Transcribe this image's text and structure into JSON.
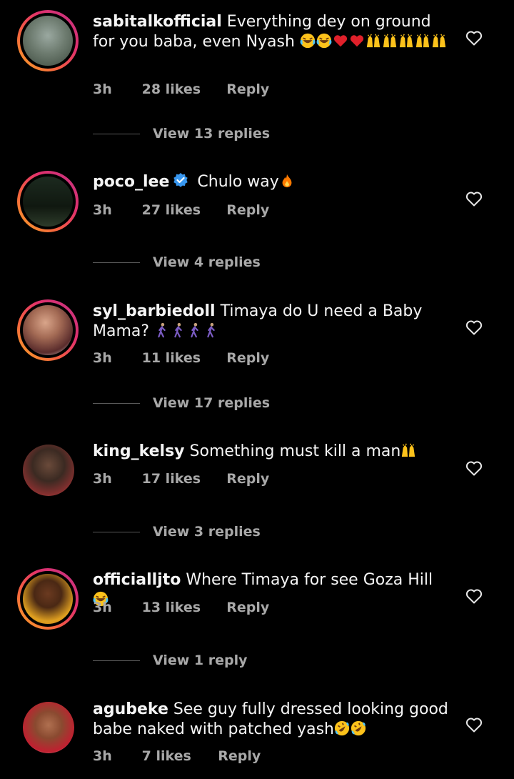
{
  "comments": [
    {
      "username": "sabitalkofficial",
      "text": "Everything dey on ground for you baba, even Nyash",
      "time": "3h",
      "likes": "28 likes",
      "reply": "Reply",
      "view_replies": "View 13 replies"
    },
    {
      "username": "poco_lee",
      "text": "Chulo way",
      "time": "3h",
      "likes": "27 likes",
      "reply": "Reply",
      "view_replies": "View 4 replies"
    },
    {
      "username": "syl_barbiedoll",
      "text": "Timaya do U need a Baby Mama?",
      "time": "3h",
      "likes": "11 likes",
      "reply": "Reply",
      "view_replies": "View 17 replies"
    },
    {
      "username": "king_kelsy",
      "text": "Something must kill a man",
      "time": "3h",
      "likes": "17 likes",
      "reply": "Reply",
      "view_replies": "View 3 replies"
    },
    {
      "username": "officialljto",
      "text": "Where Timaya for see Goza Hill",
      "time": "3h",
      "likes": "13 likes",
      "reply": "Reply",
      "view_replies": "View 1 reply"
    },
    {
      "username": "agubeke",
      "text": "See guy fully dressed looking good babe naked with patched yash",
      "time": "3h",
      "likes": "7 likes",
      "reply": "Reply"
    }
  ],
  "icons": {
    "heart": "heart-outline-icon",
    "verified": "verified-badge-icon",
    "laugh": "face-with-tears-of-joy-emoji",
    "red_heart": "red-heart-emoji",
    "raised_hands": "raising-hands-emoji",
    "fire": "fire-emoji",
    "walking": "person-walking-emoji",
    "rofl": "rolling-on-floor-laughing-emoji"
  },
  "colors": {
    "background": "#000000",
    "text": "#f5f5f5",
    "muted": "#a8a8a8",
    "verified": "#3897f0"
  }
}
